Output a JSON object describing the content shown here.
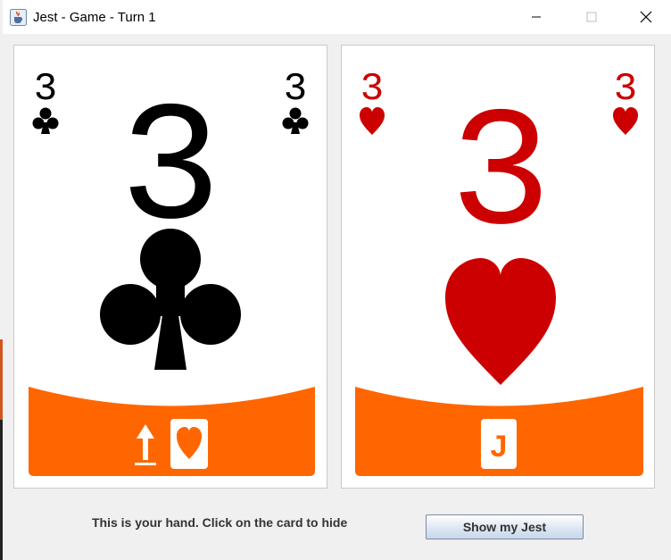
{
  "window": {
    "title": "Jest - Game - Turn 1",
    "icon": "java-cup-icon",
    "controls": [
      "minimize-icon",
      "maximize-icon",
      "close-icon"
    ]
  },
  "hand": [
    {
      "rank": "3",
      "suit": "clubs",
      "suit_color": "#000000",
      "trophy": {
        "icons": [
          "highest-arrow-icon",
          "heart-icon"
        ],
        "letter": ""
      }
    },
    {
      "rank": "3",
      "suit": "hearts",
      "suit_color": "#cc0000",
      "trophy": {
        "icons": [],
        "letter": "J"
      }
    }
  ],
  "colors": {
    "trophy_band": "#ff6600",
    "clubs": "#000000",
    "hearts": "#cc0000"
  },
  "footer": {
    "hint": "This is your hand. Click on the card to hide",
    "show_jest_label": "Show my Jest"
  }
}
